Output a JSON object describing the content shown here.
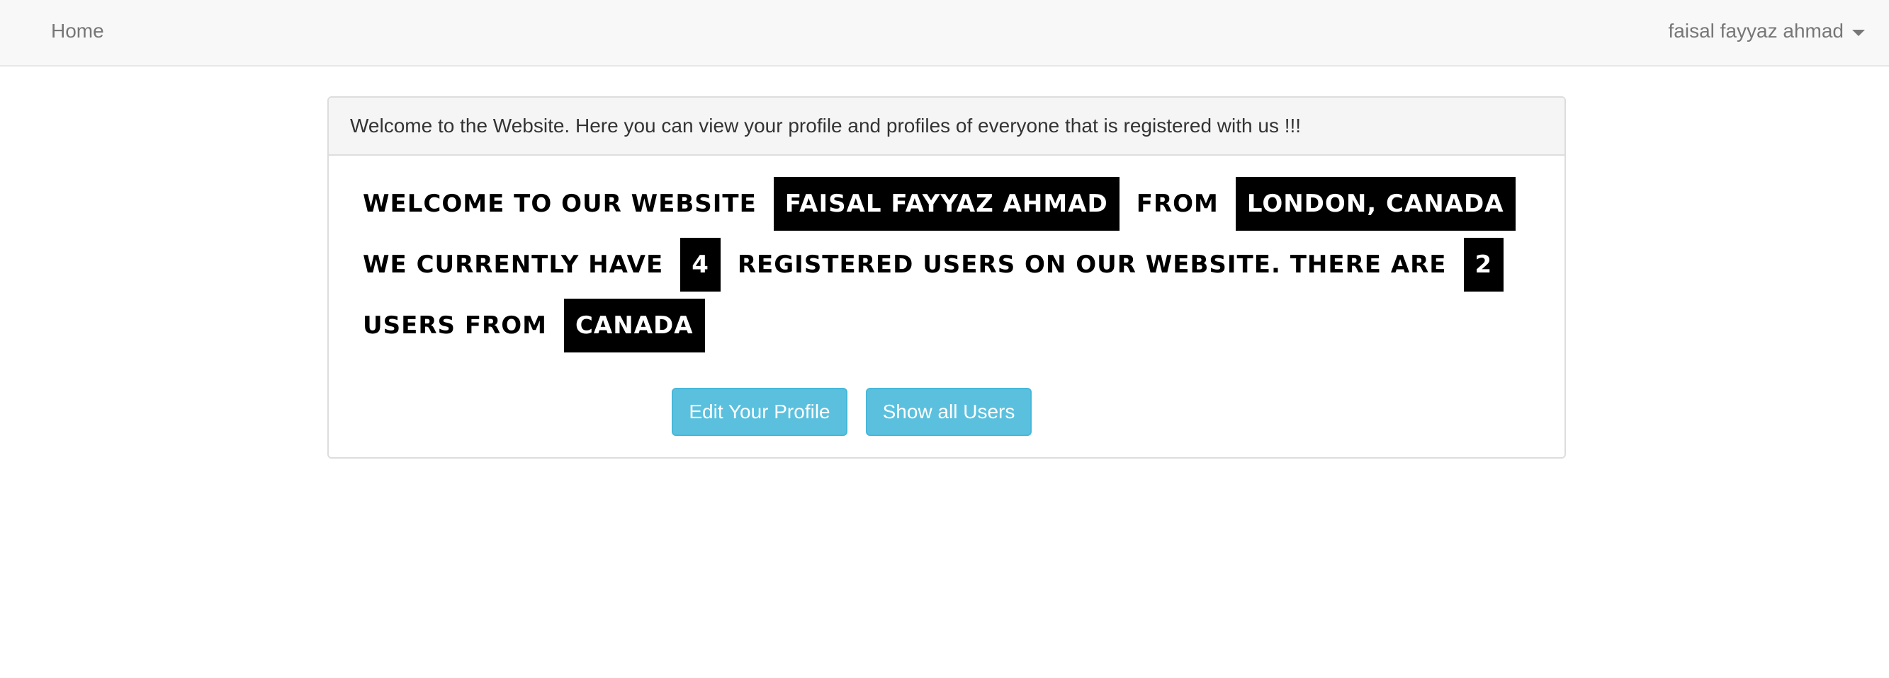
{
  "navbar": {
    "home_label": "Home",
    "user_label": "faisal fayyaz ahmad"
  },
  "panel": {
    "heading": "Welcome to the Website. Here you can view your profile and profiles of everyone that is registered with us !!!",
    "line1": {
      "prefix": "WELCOME TO OUR WEBSITE",
      "name": "FAISAL FAYYAZ AHMAD",
      "from": "FROM",
      "location": "LONDON, CANADA"
    },
    "line2": {
      "prefix": "WE CURRENTLY HAVE",
      "user_count": "4",
      "middle": "REGISTERED USERS ON OUR WEBSITE. THERE ARE",
      "country_count": "2"
    },
    "line3": {
      "prefix": "USERS FROM",
      "country": "CANADA"
    },
    "buttons": {
      "edit_profile": "Edit Your Profile",
      "show_users": "Show all Users"
    }
  },
  "colors": {
    "button_bg": "#5bc0de",
    "badge_bg": "#000000",
    "navbar_bg": "#f8f8f8"
  }
}
